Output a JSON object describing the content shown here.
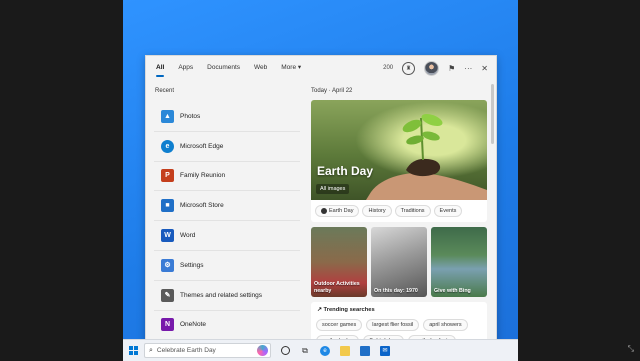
{
  "tabs": [
    "All",
    "Apps",
    "Documents",
    "Web",
    "More"
  ],
  "more_caret": "▾",
  "points": "200",
  "recent": {
    "title": "Recent",
    "items": [
      {
        "label": "Photos",
        "icon": "photos-icon",
        "color": "#2b88d8",
        "glyph": "▲"
      },
      {
        "label": "Microsoft Edge",
        "icon": "edge-icon",
        "color": "#0f7fcf",
        "glyph": "e"
      },
      {
        "label": "Family Reunion",
        "icon": "powerpoint-icon",
        "color": "#c43e1c",
        "glyph": "P"
      },
      {
        "label": "Microsoft Store",
        "icon": "store-icon",
        "color": "#1f6fc7",
        "glyph": "■"
      },
      {
        "label": "Word",
        "icon": "word-icon",
        "color": "#185abd",
        "glyph": "W"
      },
      {
        "label": "Settings",
        "icon": "settings-icon",
        "color": "#3a7bd5",
        "glyph": "⚙"
      },
      {
        "label": "Themes and related settings",
        "icon": "themes-icon",
        "color": "#5a5a5a",
        "glyph": "✎"
      },
      {
        "label": "OneNote",
        "icon": "onenote-icon",
        "color": "#7719aa",
        "glyph": "N"
      }
    ]
  },
  "today": {
    "label": "Today",
    "separator": "·",
    "date": "April 22"
  },
  "hero": {
    "title": "Earth Day",
    "button": "All images"
  },
  "chips": [
    "Earth Day",
    "History",
    "Traditions",
    "Events"
  ],
  "cards": [
    {
      "label": "Outdoor Activities nearby"
    },
    {
      "label": "On this day: 1970"
    },
    {
      "label": "Give with Bing"
    }
  ],
  "trending": {
    "title": "Trending searches",
    "items": [
      "soccer games",
      "largest flier fossil",
      "april showers",
      "mother's day",
      "flight delays",
      "earth day facts"
    ]
  },
  "taskbar": {
    "search_placeholder": "Celebrate Earth Day"
  }
}
